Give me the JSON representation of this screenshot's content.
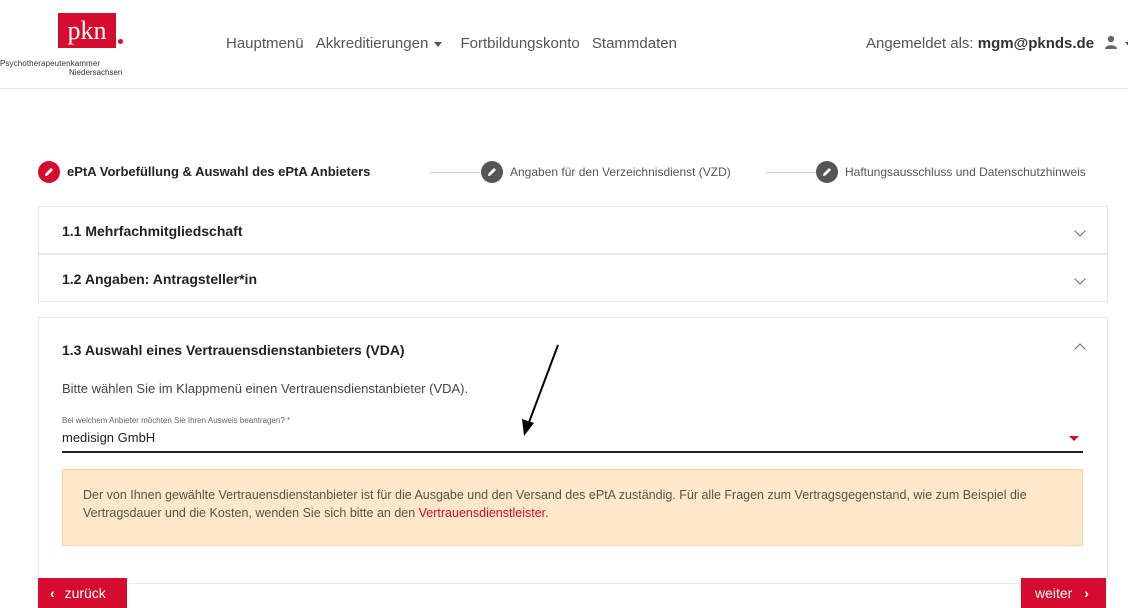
{
  "header": {
    "logo": {
      "brand": "pkn",
      "org_line1": "Psychotherapeutenkammer",
      "org_line2": "Niedersachsen"
    },
    "nav": [
      "Hauptmenü",
      "Akkreditierungen",
      "Fortbildungskonto",
      "Stammdaten"
    ],
    "user": {
      "prefix": "Angemeldet als:",
      "email": "mgm@pknds.de"
    }
  },
  "stepper": {
    "steps": [
      {
        "label": "ePtA Vorbefüllung & Auswahl des ePtA Anbieters",
        "state": "active"
      },
      {
        "label": "Angaben für den Verzeichnisdienst (VZD)",
        "state": "inactive"
      },
      {
        "label": "Haftungsausschluss und Datenschutzhinweis",
        "state": "inactive"
      }
    ]
  },
  "sections": [
    {
      "title": "1.1 Mehrfachmitgliedschaft",
      "expanded": false
    },
    {
      "title": "1.2 Angaben: Antragsteller*in",
      "expanded": false
    },
    {
      "title": "1.3 Auswahl eines Vertrauensdienstanbieters (VDA)",
      "expanded": true
    }
  ],
  "vda": {
    "instruction": "Bitte wählen Sie im Klappmenü einen Vertrauensdienstanbieter (VDA).",
    "select_label": "Bei welchem Anbieter möchten Sie Ihren Ausweis beantragen? *",
    "select_value": "medisign GmbH",
    "notice_text": "Der von Ihnen gewählte Vertrauensdienstanbieter ist für die Ausgabe und den Versand des ePtA zuständig. Für alle Fragen zum Vertragsgegenstand, wie zum Beispiel die Vertragsdauer und die Kosten, wenden Sie sich bitte an den ",
    "notice_link": "Vertrauensdienstleister",
    "notice_end": "."
  },
  "buttons": {
    "back": "zurück",
    "next": "weiter"
  },
  "colors": {
    "accent": "#d50c2f",
    "inactive": "#555555",
    "notice_bg": "#fde9c9"
  },
  "icons": {
    "step": "pencil-icon",
    "user": "user-icon",
    "back": "chevron-left-icon",
    "next": "chevron-right-icon"
  }
}
